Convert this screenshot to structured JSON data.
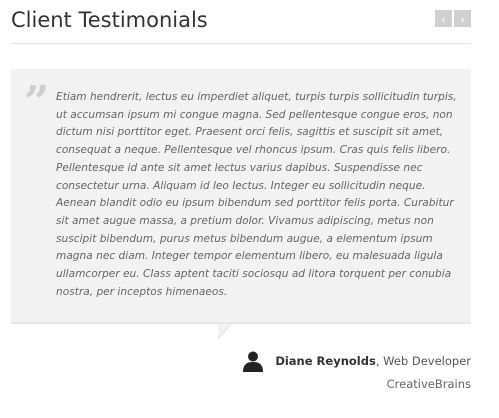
{
  "header": {
    "title": "Client Testimonials",
    "prev_icon": "chevron-left-icon",
    "next_icon": "chevron-right-icon",
    "prev_glyph": "‹",
    "next_glyph": "›"
  },
  "testimonial": {
    "quote_icon": "quote-icon",
    "quote_glyph": "”",
    "text": "Etiam hendrerit, lectus eu imperdiet aliquet, turpis turpis sollicitudin turpis, ut accumsan ipsum mi congue magna. Sed pellentesque congue eros, non dictum nisi porttitor eget. Praesent orci felis, sagittis et suscipit sit amet, consequat a neque. Pellentesque vel rhoncus ipsum. Cras quis felis libero. Pellentesque id ante sit amet lectus varius dapibus. Suspendisse nec consectetur urna. Aliquam id leo lectus. Integer eu sollicitudin neque. Aenean blandit odio eu ipsum bibendum sed porttitor felis porta. Curabitur sit amet augue massa, a pretium dolor. Vivamus adipiscing, metus non suscipit bibendum, purus metus bibendum augue, a elementum ipsum magna nec diam. Integer tempor elementum libero, eu malesuada ligula ullamcorper eu. Class aptent taciti sociosqu ad litora torquent per conubia nostra, per inceptos himenaeos.",
    "author": {
      "avatar_icon": "user-icon",
      "name": "Diane Reynolds",
      "separator": ", ",
      "role": "Web Developer",
      "company": "CreativeBrains"
    }
  },
  "colors": {
    "background": "#ffffff",
    "quote_bg": "#f2f2f2",
    "nav_button": "#d0d0d0",
    "quote_mark": "#cfcfcf",
    "text": "#666666"
  }
}
